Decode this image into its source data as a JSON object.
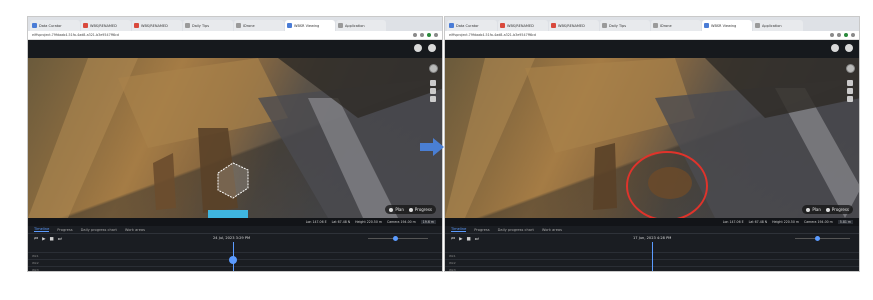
{
  "left": {
    "tabs": [
      {
        "label": "Data Curator",
        "fav": "blue"
      },
      {
        "label": "WBS/RENAMED",
        "fav": "red"
      },
      {
        "label": "WBS/RENAMED",
        "fav": "red"
      },
      {
        "label": "Daily Tips",
        "fav": "grey"
      },
      {
        "label": "IDrone",
        "fav": "grey"
      },
      {
        "label": "WBSR Viewing",
        "fav": "blue"
      },
      {
        "label": "Application",
        "fav": "grey"
      }
    ],
    "url": "eiffvproject.79fdaab4-51fa-4ad8-a321-b3e9547ff6cd",
    "coords": [
      "Lon 147.06 E",
      "Lat 67.48 N",
      "Height 220.50 m",
      "Camera 194.00 m"
    ],
    "zoom": "19.6 m",
    "toggle": {
      "opt1": "Plan",
      "opt2": "Progress"
    },
    "panel_tabs": [
      "Timeline",
      "Progress",
      "Daily progress chart",
      "Work areas"
    ],
    "date": "24 Jul, 2023 3:29 PM",
    "rows": [
      "Wk1",
      "Wk2",
      "Wk3"
    ]
  },
  "right": {
    "tabs": [
      {
        "label": "Data Curator",
        "fav": "blue"
      },
      {
        "label": "WBS/RENAMED",
        "fav": "red"
      },
      {
        "label": "WBS/RENAMED",
        "fav": "red"
      },
      {
        "label": "Daily Tips",
        "fav": "grey"
      },
      {
        "label": "IDrone",
        "fav": "grey"
      },
      {
        "label": "WBSR Viewing",
        "fav": "blue"
      },
      {
        "label": "Application",
        "fav": "grey"
      }
    ],
    "url": "eiffvproject.79fdaab4-51fa-4ad8-a321-b3e9547ff6cd",
    "coords": [
      "Lon 147.06 E",
      "Lat 67.48 N",
      "Height 220.50 m",
      "Camera 194.00 m"
    ],
    "zoom": "5.81 m",
    "toggle": {
      "opt1": "Plan",
      "opt2": "Progress"
    },
    "panel_tabs": [
      "Timeline",
      "Progress",
      "Daily progress chart",
      "Work areas"
    ],
    "date": "17 Jun, 2023 4:28 PM",
    "rows": [
      "Wk1",
      "Wk2",
      "Wk3"
    ]
  },
  "colors": {
    "accent": "#5b9bff",
    "highlight": "#e0332b",
    "arrow": "#4a7fd4"
  }
}
